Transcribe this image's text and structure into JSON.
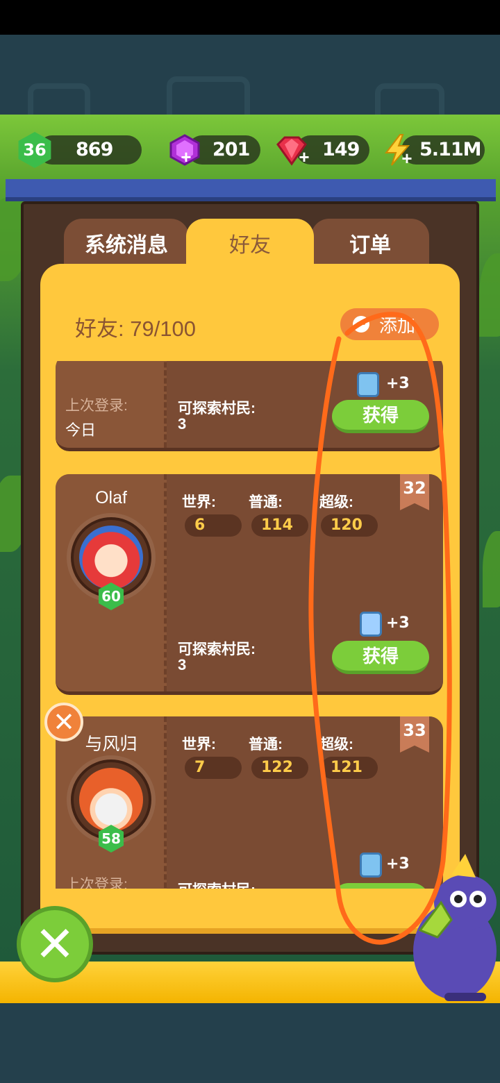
{
  "resources": {
    "level": "36",
    "xp": "869",
    "purple_gems": "201",
    "red_gems": "149",
    "energy": "5.11M",
    "plus_symbol": "+"
  },
  "tabs": {
    "system": "系统消息",
    "friends": "好友",
    "orders": "订单"
  },
  "header": {
    "friends_count": "好友: 79/100",
    "add_label": "添加"
  },
  "labels": {
    "world": "世界:",
    "normal": "普通:",
    "super": "超级:",
    "explorable": "可探索村民:",
    "last_login": "上次登录:",
    "get": "获得"
  },
  "friends": [
    {
      "last_login_value": "今日",
      "explorable": "3",
      "reward": "+3"
    },
    {
      "name": "Olaf",
      "level": "60",
      "rank": "32",
      "world": "6",
      "normal": "114",
      "super": "120",
      "explorable": "3",
      "reward": "+3"
    },
    {
      "name": "与风归",
      "level": "58",
      "rank": "33",
      "world": "7",
      "normal": "122",
      "super": "121",
      "reward": "+3"
    }
  ],
  "colors": {
    "panel": "#ffc83d",
    "card": "#7a4b33",
    "button_green": "#7ccd3a",
    "accent_orange": "#f0823a",
    "annotation": "#ff6a1a"
  },
  "icons": {
    "remove": "✕",
    "close": "✕"
  }
}
